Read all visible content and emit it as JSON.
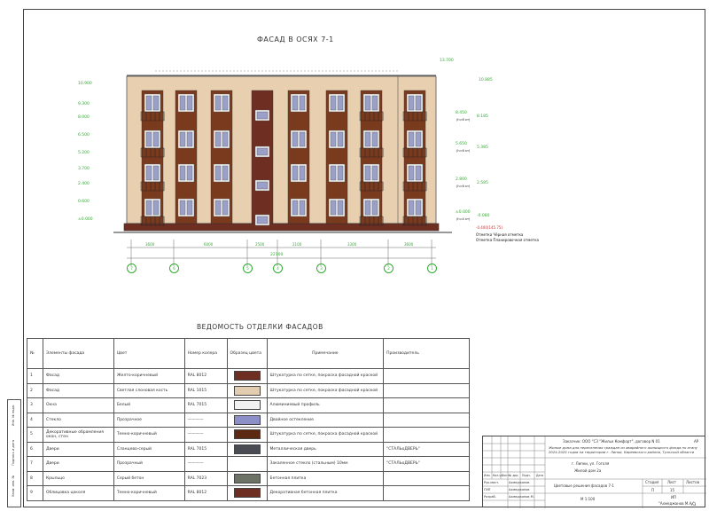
{
  "facade": {
    "title": "ФАСАД В ОСЯХ 7-1",
    "levels_left": [
      "10.900",
      "9.300",
      "8.000",
      "6.500",
      "5.200",
      "3.700",
      "2.400",
      "0.600",
      "±0.000"
    ],
    "levels_right_top": [
      "13.700",
      "10.885"
    ],
    "levels_right_pairs": [
      {
        "a": "8.450",
        "b": "8.185",
        "note": "(h=6 кт)"
      },
      {
        "a": "5.650",
        "b": "5.385",
        "note": "(h=6 кт)"
      },
      {
        "a": "2.800",
        "b": "2.585",
        "note": "(h=6 кт)"
      },
      {
        "a": "±0.000",
        "b": "-0.080",
        "note": "(h=4 кт)"
      }
    ],
    "ground_level": "-0.400(145.75)",
    "ground_note_1": "Отметка Чёрная отметка",
    "ground_note_2": "Отметка Планировочная отметка",
    "dims": [
      "3600",
      "6000",
      "2500",
      "2100",
      "3300",
      "3600"
    ],
    "total_dim": "22100",
    "axes": [
      "7",
      "6",
      "5",
      "4",
      "3",
      "2",
      "1"
    ]
  },
  "schedule": {
    "title": "ВЕДОМОСТЬ ОТДЕЛКИ ФАСАДОВ",
    "headers": {
      "num": "№",
      "element": "Элементы фасада",
      "color": "Цвет",
      "code": "Номер колера",
      "sample": "Образец цвета",
      "note": "Примечание",
      "maker": "Производитель"
    },
    "rows": [
      {
        "n": "1",
        "el": "Фасад",
        "color": "Желто-коричневый",
        "code": "RAL 8012",
        "swatch": "#6e2e22",
        "note": "Штукатурка по сетке, покраска фасадной краской",
        "maker": ""
      },
      {
        "n": "2",
        "el": "Фасад",
        "color": "Светлая слоновая кость",
        "code": "RAL 1015",
        "swatch": "#e3cdb0",
        "note": "Штукатурка по сетке, покраска фасадной краской",
        "maker": ""
      },
      {
        "n": "3",
        "el": "Окна",
        "color": "Белый",
        "code": "RAL 7015",
        "swatch": "#f2f2f2",
        "note": "Алюминиевый профиль",
        "maker": ""
      },
      {
        "n": "4",
        "el": "Стекло",
        "color": "Прозрачное",
        "code": "————",
        "swatch": "#8d8fc9",
        "note": "Двойное остекление",
        "maker": ""
      },
      {
        "n": "5",
        "el": "Декоративные обрамления окон, стен",
        "color": "Темно-коричневый",
        "code": "————",
        "swatch": "#5c2a12",
        "note": "Штукатурка по сетке, покраска фасадной краской",
        "maker": ""
      },
      {
        "n": "6",
        "el": "Двери",
        "color": "Сланцево-серый",
        "code": "RAL 7015",
        "swatch": "#4a4c54",
        "note": "Металлическая дверь",
        "maker": "\"СТАЛЬоДВЕРЬ\""
      },
      {
        "n": "7",
        "el": "Двери",
        "color": "Прозрачный",
        "code": "————",
        "swatch": "",
        "note": "Закаленное стекло (стальным) 10мм",
        "maker": "\"СТАЛЬоДВЕРЬ\""
      },
      {
        "n": "8",
        "el": "Крыльцо",
        "color": "Серый бетон",
        "code": "RAL 7023",
        "swatch": "#6d7266",
        "note": "Бетонная плитка",
        "maker": ""
      },
      {
        "n": "9",
        "el": "Облицовка цоколя",
        "color": "Темно-коричневый",
        "code": "RAL 8012",
        "swatch": "#6e2e22",
        "note": "Декоративная бетонная плитка",
        "maker": ""
      }
    ]
  },
  "stamp": {
    "customer": "Заказчик: ООО \"СЗ \"Жилье Комфорт\", договор N 01",
    "code": "АР",
    "project": "Жилые дома для переселения граждан из аварийного жилищного фонда по этапу 2024-2025 годов на территории г. Липки, Киреевского района, Тульской области",
    "address": "г. Липки, ул. Гоголя",
    "building": "Жилой дом 2а",
    "sheet_title": "Цветовые решения фасадов 7-1",
    "scale": "М 1:100",
    "stage_h": "Стадия",
    "sheet_h": "Лист",
    "sheets_h": "Листов",
    "stage": "П",
    "sheet": "15",
    "org_1": "ИП",
    "org_2": "\"Ахмеджанов М.А.\"",
    "cols": [
      "Изм.",
      "Кол.уч.",
      "Лист",
      "№ док.",
      "Подп.",
      "Дата"
    ],
    "roles": [
      {
        "role": "Рук.маст.",
        "name": "Ахмеджанов"
      },
      {
        "role": "ГИП",
        "name": "Ахмеджанов"
      },
      {
        "role": "Разраб.",
        "name": "Ахмеджанов М."
      }
    ],
    "format": "А3"
  },
  "side_stamp": [
    "Инв. № подл.",
    "Подпись и дата",
    "Взам. инв. №"
  ]
}
